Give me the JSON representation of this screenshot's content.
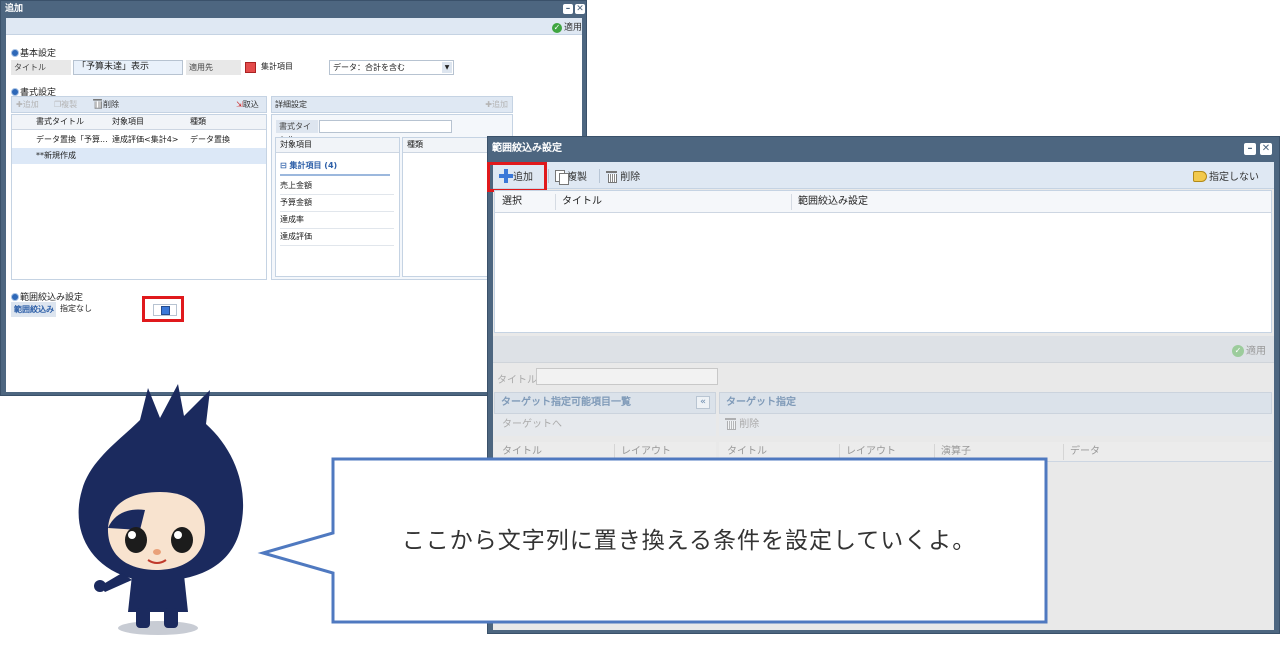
{
  "colors": {
    "window_frame": "#4d6680",
    "toolbar": "#dfe8f3",
    "highlight_box": "#e0191c",
    "bubble_border": "#4f79c0",
    "character": "#1b2a5e"
  },
  "window1": {
    "title": "追加",
    "apply_label": "適用",
    "basic_section": "基本設定",
    "title_label": "タイトル",
    "title_value": "「予算未達」表示",
    "target_label": "適用先",
    "target_value": "集計項目",
    "data_select": "データ：合計を含む",
    "format_section": "書式設定",
    "toolbar": {
      "add": "追加",
      "copy": "複製",
      "delete": "削除",
      "import": "取込"
    },
    "grid_headers": [
      "書式タイトル",
      "対象項目",
      "種類"
    ],
    "rows": [
      {
        "title": "データ置換「予算...",
        "target": "達成評価<集計4>",
        "kind": "データ置換"
      },
      {
        "title": "**新規作成",
        "target": "",
        "kind": ""
      }
    ],
    "detail": {
      "header": "詳細設定",
      "add": "追加",
      "format_title_label": "書式タイトル",
      "col_target": "対象項目",
      "col_kind": "種類",
      "group": "集計項目 (4)",
      "items": [
        "売上金額",
        "予算金額",
        "達成率",
        "達成評価"
      ]
    },
    "filter_section": "範囲絞込み設定",
    "filter_label": "範囲絞込み",
    "filter_value": "指定なし"
  },
  "window2": {
    "title": "範囲絞込み設定",
    "toolbar": {
      "add": "追加",
      "copy": "複製",
      "delete": "削除",
      "none": "指定しない"
    },
    "grid_headers": [
      "選択",
      "タイトル",
      "範囲絞込み設定"
    ],
    "apply_label": "適用",
    "title_label": "タイトル",
    "left_panel": {
      "header": "ターゲット指定可能項目一覧",
      "to_target": "ターゲットへ",
      "cols": [
        "タイトル",
        "レイアウト"
      ],
      "collapse": "«"
    },
    "right_panel": {
      "header": "ターゲット指定",
      "delete": "削除",
      "cols": [
        "タイトル",
        "レイアウト",
        "演算子",
        "データ"
      ]
    }
  },
  "bubble": {
    "text": "ここから文字列に置き換える条件を設定していくよ。"
  }
}
